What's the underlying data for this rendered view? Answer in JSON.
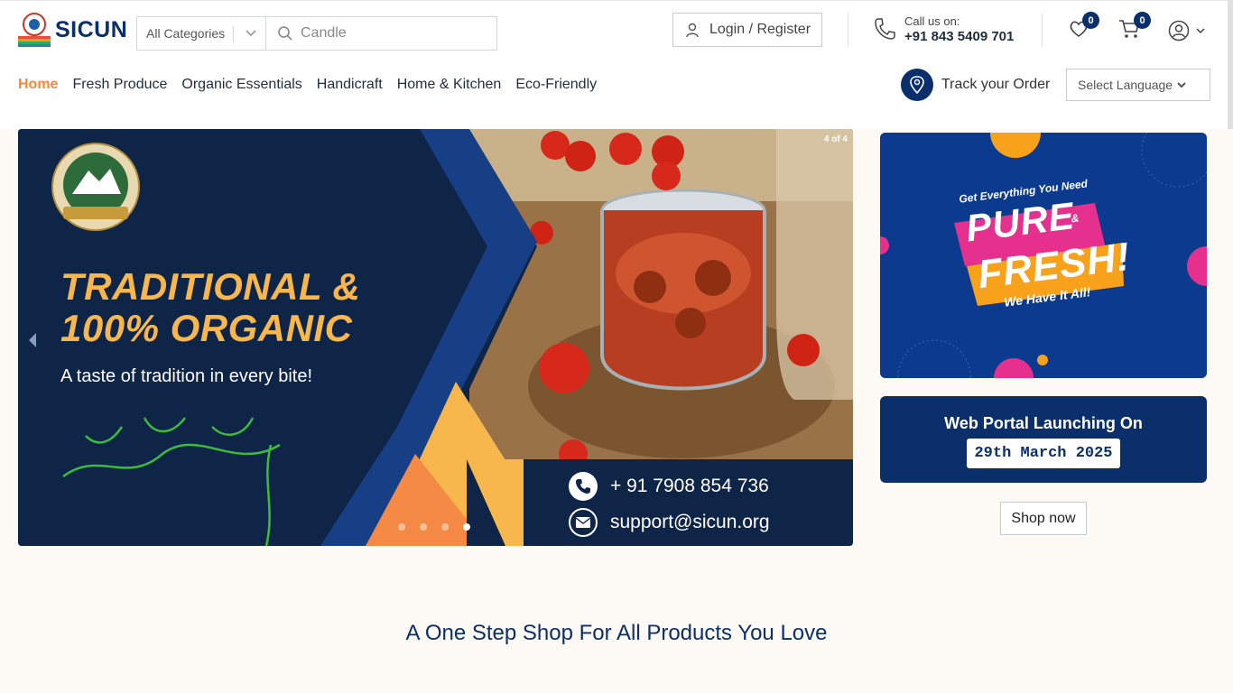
{
  "brand": {
    "name": "SICUN"
  },
  "search": {
    "category": "All Categories",
    "placeholder": "Candle"
  },
  "header": {
    "login_label": "Login / Register",
    "call_label": "Call us on:",
    "call_number": "+91 843 5409 701",
    "wishlist_count": "0",
    "cart_count": "0"
  },
  "nav": {
    "items": [
      "Home",
      "Fresh Produce",
      "Organic Essentials",
      "Handicraft",
      "Home & Kitchen",
      "Eco-Friendly"
    ],
    "active": "Home",
    "track_label": "Track your Order",
    "language_label": "Select Language"
  },
  "hero": {
    "title_line1": "TRADITIONAL &",
    "title_line2": "100% ORGANIC",
    "subtitle": "A taste of tradition in every bite!",
    "counter": "4 of 4",
    "phone": "+ 91 7908 854 736",
    "email": "support@sicun.org",
    "slides_total": 4,
    "slide_active": 4
  },
  "promo": {
    "tagline": "Get Everything You Need",
    "word1": "PURE",
    "joiner": "&",
    "word2": "FRESH!",
    "footer": "We Have It All!"
  },
  "launch": {
    "title": "Web Portal Launching On",
    "date": "29th March 2025"
  },
  "cta": {
    "shop_now": "Shop now"
  },
  "section": {
    "title": "A One Step Shop For All Products You Love"
  },
  "colors": {
    "navy": "#0b2f6b",
    "orange": "#f08a3c",
    "gold": "#f7b74c",
    "background": "#fdf9f4"
  },
  "icons": [
    "user-icon",
    "phone-icon",
    "heart-icon",
    "cart-icon",
    "account-icon",
    "search-icon",
    "location-icon",
    "chevron-down-icon",
    "chevron-left-icon",
    "mail-icon"
  ]
}
